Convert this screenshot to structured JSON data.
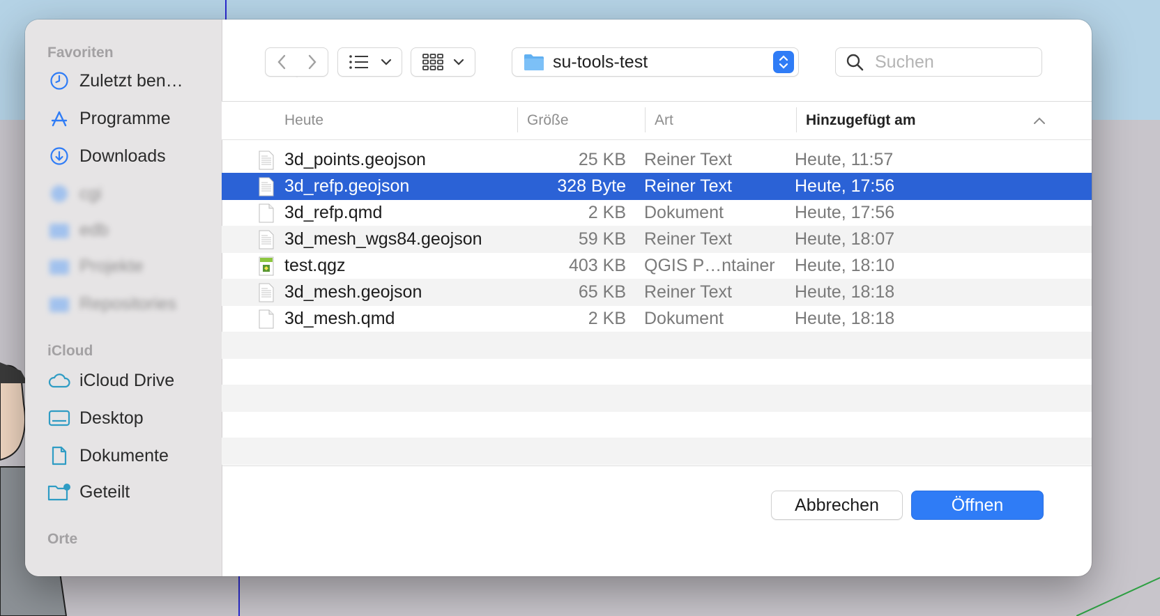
{
  "sidebar": {
    "favorites_heading": "Favoriten",
    "favorites": [
      {
        "label": "Zuletzt ben…",
        "icon": "clock-icon"
      },
      {
        "label": "Programme",
        "icon": "app-store-icon"
      },
      {
        "label": "Downloads",
        "icon": "download-icon"
      },
      {
        "label": "cgi",
        "icon": "globe-icon"
      },
      {
        "label": "edb",
        "icon": "folder-icon"
      },
      {
        "label": "Projekte",
        "icon": "folder-icon"
      },
      {
        "label": "Repositories",
        "icon": "folder-icon"
      }
    ],
    "icloud_heading": "iCloud",
    "icloud": [
      {
        "label": "iCloud Drive",
        "icon": "cloud-icon"
      },
      {
        "label": "Desktop",
        "icon": "desktop-icon"
      },
      {
        "label": "Dokumente",
        "icon": "document-icon"
      },
      {
        "label": "Geteilt",
        "icon": "shared-folder-icon"
      }
    ],
    "places_heading": "Orte"
  },
  "toolbar": {
    "back_icon": "chevron-left-icon",
    "forward_icon": "chevron-right-icon",
    "list_view_icon": "list-icon",
    "group_icon": "grid-icon",
    "current_folder": "su-tools-test",
    "search_placeholder": "Suchen",
    "search_value": ""
  },
  "table": {
    "columns": [
      "Heute",
      "Größe",
      "Art",
      "Hinzugefügt am"
    ],
    "sorted_column": "Hinzugefügt am",
    "rows": [
      {
        "name": "3d_points.geojson",
        "size": "25 KB",
        "kind": "Reiner Text",
        "date": "Heute, 11:57",
        "icon": "text-file-icon"
      },
      {
        "name": "3d_refp.geojson",
        "size": "328 Byte",
        "kind": "Reiner Text",
        "date": "Heute, 17:56",
        "icon": "text-file-icon",
        "selected": true
      },
      {
        "name": "3d_refp.qmd",
        "size": "2 KB",
        "kind": "Dokument",
        "date": "Heute, 17:56",
        "icon": "blank-file-icon"
      },
      {
        "name": "3d_mesh_wgs84.geojson",
        "size": "59 KB",
        "kind": "Reiner Text",
        "date": "Heute, 18:07",
        "icon": "text-file-icon"
      },
      {
        "name": "test.qgz",
        "size": "403 KB",
        "kind": "QGIS P…ntainer",
        "date": "Heute, 18:10",
        "icon": "qgis-file-icon"
      },
      {
        "name": "3d_mesh.geojson",
        "size": "65 KB",
        "kind": "Reiner Text",
        "date": "Heute, 18:18",
        "icon": "text-file-icon"
      },
      {
        "name": "3d_mesh.qmd",
        "size": "2 KB",
        "kind": "Dokument",
        "date": "Heute, 18:18",
        "icon": "blank-file-icon"
      }
    ]
  },
  "buttons": {
    "cancel": "Abbrechen",
    "open": "Öffnen"
  },
  "colors": {
    "accent": "#2f7cf6",
    "selection": "#2b62d6",
    "sidebar_icon": "#2f7cf6"
  }
}
